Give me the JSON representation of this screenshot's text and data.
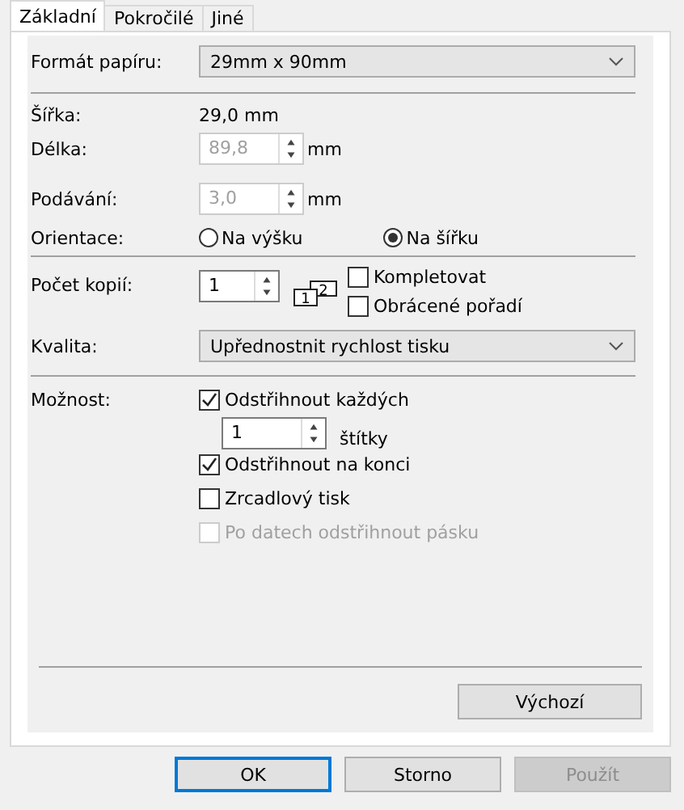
{
  "tabs": [
    {
      "label": "Základní",
      "selected": true
    },
    {
      "label": "Pokročilé",
      "selected": false
    },
    {
      "label": "Jiné",
      "selected": false
    }
  ],
  "paper_format": {
    "label": "Formát papíru:",
    "value": "29mm x 90mm"
  },
  "width": {
    "label": "Šířka:",
    "value": "29,0 mm"
  },
  "length": {
    "label": "Délka:",
    "value": "89,8",
    "unit": "mm",
    "disabled": true
  },
  "feed": {
    "label": "Podávání:",
    "value": "3,0",
    "unit": "mm",
    "disabled": true
  },
  "orientation": {
    "label": "Orientace:",
    "options": [
      {
        "label": "Na výšku",
        "selected": false
      },
      {
        "label": "Na šířku",
        "selected": true
      }
    ]
  },
  "copies": {
    "label": "Počet kopií:",
    "value": "1",
    "disabled": false,
    "icon_digits": [
      "1",
      "2"
    ],
    "collate": {
      "label": "Kompletovat",
      "checked": false
    },
    "reverse": {
      "label": "Obrácené pořadí",
      "checked": false
    }
  },
  "quality": {
    "label": "Kvalita:",
    "value": "Upřednostnit rychlost tisku"
  },
  "options": {
    "label": "Možnost:",
    "cut_every": {
      "label": "Odstřihnout každých",
      "checked": true,
      "value": "1",
      "unit": "štítky",
      "disabled": false
    },
    "checks": [
      {
        "label": "Odstřihnout na konci",
        "checked": true,
        "disabled": false
      },
      {
        "label": "Zrcadlový tisk",
        "checked": false,
        "disabled": false
      },
      {
        "label": "Po datech odstřihnout pásku",
        "checked": false,
        "disabled": true
      }
    ]
  },
  "default_button": {
    "label": "Výchozí"
  },
  "buttons": [
    {
      "label": "OK",
      "focused": true,
      "disabled": false
    },
    {
      "label": "Storno",
      "focused": false,
      "disabled": false
    },
    {
      "label": "Použít",
      "focused": false,
      "disabled": true
    }
  ]
}
